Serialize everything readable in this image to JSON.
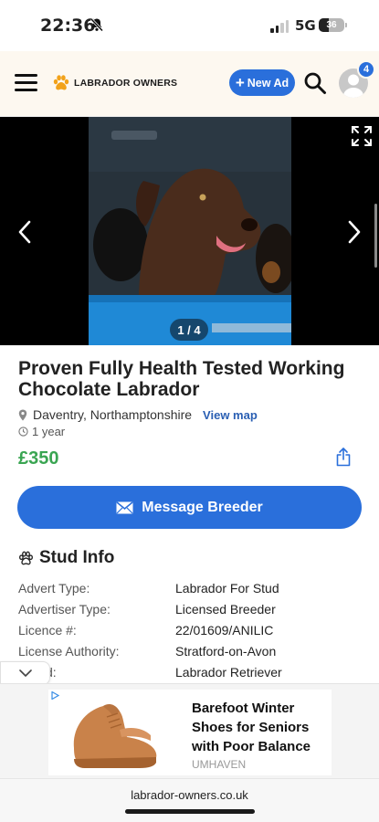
{
  "status_bar": {
    "time": "22:36",
    "network": "5G",
    "battery": "36"
  },
  "header": {
    "brand": "LABRADOR OWNERS",
    "new_ad_label": "New Ad",
    "notification_count": "4"
  },
  "gallery": {
    "counter": "1 / 4"
  },
  "listing": {
    "title": "Proven Fully Health Tested Working Chocolate Labrador",
    "location": "Daventry, Northamptonshire",
    "view_map": "View map",
    "age": "1 year",
    "price": "£350",
    "message_button": "Message Breeder"
  },
  "stud_info": {
    "heading": "Stud Info",
    "rows": [
      {
        "key": "Advert Type:",
        "value": "Labrador For Stud"
      },
      {
        "key": "Advertiser Type:",
        "value": "Licensed Breeder"
      },
      {
        "key": "Licence #:",
        "value": "22/01609/ANILIC"
      },
      {
        "key": "License Authority:",
        "value": "Stratford-on-Avon"
      },
      {
        "key": "d:",
        "value": "Labrador Retriever"
      }
    ]
  },
  "ad": {
    "text": "Barefoot Winter Shoes for Seniors with Poor Balance",
    "brand": "UMHAVEN"
  },
  "browser": {
    "url": "labrador-owners.co.uk"
  },
  "colors": {
    "accent": "#2a6fdb",
    "price": "#3aa552",
    "link": "#2a5fb3",
    "header_bg": "#fdf8f0"
  },
  "icons": [
    "bell-slash-icon",
    "hamburger-icon",
    "paw-icon",
    "search-icon",
    "avatar-icon",
    "expand-icon",
    "chevron-left-icon",
    "chevron-right-icon",
    "pin-icon",
    "clock-icon",
    "share-icon",
    "envelope-icon",
    "chevron-down-icon"
  ]
}
